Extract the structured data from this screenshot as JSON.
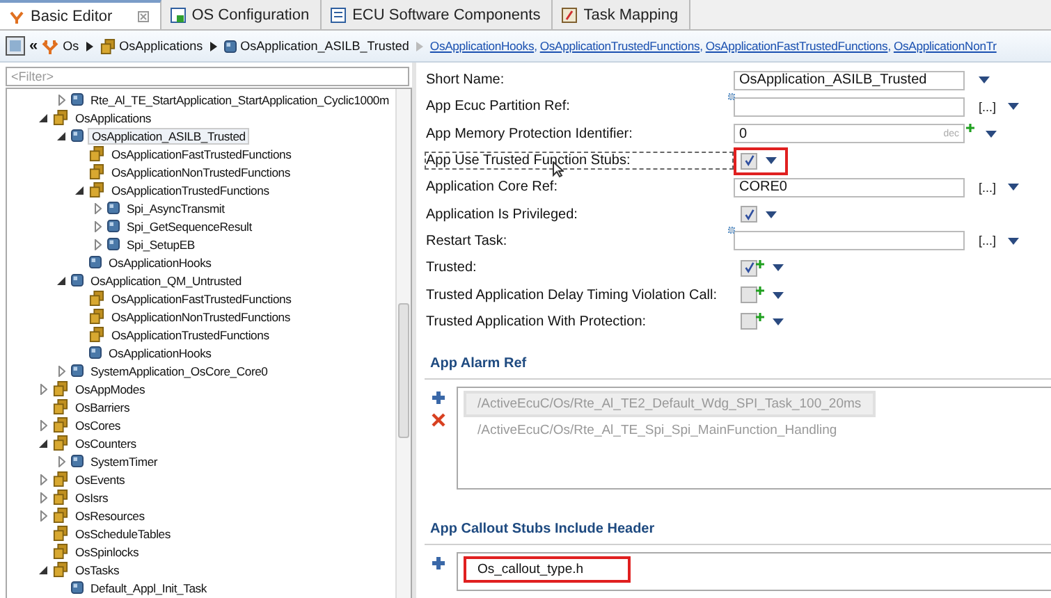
{
  "tabs": [
    {
      "label": "Basic Editor",
      "selected": true
    },
    {
      "label": "OS Configuration",
      "selected": false
    },
    {
      "label": "ECU Software Components",
      "selected": false
    },
    {
      "label": "Task Mapping",
      "selected": false
    }
  ],
  "breadcrumb": {
    "back_glyph": "«",
    "items": [
      {
        "label": "Os"
      },
      {
        "label": "OsApplications"
      },
      {
        "label": "OsApplication_ASILB_Trusted"
      }
    ],
    "links": [
      "OsApplicationHooks",
      "OsApplicationTrustedFunctions",
      "OsApplicationFastTrustedFunctions",
      "OsApplicationNonTr"
    ],
    "link_separator": ","
  },
  "filter": {
    "placeholder": "<Filter>"
  },
  "tree": {
    "continued_children": [
      {
        "label": "Rte_Al_TE_StartApplication_StartApplication_Cyclic1000m",
        "kind": "item",
        "expanded": false
      }
    ],
    "items": [
      {
        "label": "OsApplications",
        "kind": "container",
        "expanded": true,
        "children": [
          {
            "label": "OsApplication_ASILB_Trusted",
            "kind": "item",
            "expanded": true,
            "selected": true,
            "children": [
              {
                "label": "OsApplicationFastTrustedFunctions",
                "kind": "container"
              },
              {
                "label": "OsApplicationNonTrustedFunctions",
                "kind": "container"
              },
              {
                "label": "OsApplicationTrustedFunctions",
                "kind": "container",
                "expanded": true,
                "children": [
                  {
                    "label": "Spi_AsyncTransmit",
                    "kind": "item",
                    "expanded": false
                  },
                  {
                    "label": "Spi_GetSequenceResult",
                    "kind": "item",
                    "expanded": false
                  },
                  {
                    "label": "Spi_SetupEB",
                    "kind": "item",
                    "expanded": false
                  }
                ]
              },
              {
                "label": "OsApplicationHooks",
                "kind": "item"
              }
            ]
          },
          {
            "label": "OsApplication_QM_Untrusted",
            "kind": "item",
            "expanded": true,
            "selected": false,
            "children": [
              {
                "label": "OsApplicationFastTrustedFunctions",
                "kind": "container"
              },
              {
                "label": "OsApplicationNonTrustedFunctions",
                "kind": "container"
              },
              {
                "label": "OsApplicationTrustedFunctions",
                "kind": "container"
              },
              {
                "label": "OsApplicationHooks",
                "kind": "item"
              }
            ]
          },
          {
            "label": "SystemApplication_OsCore_Core0",
            "kind": "item",
            "expanded": false
          }
        ]
      },
      {
        "label": "OsAppModes",
        "kind": "container",
        "expanded": false
      },
      {
        "label": "OsBarriers",
        "kind": "container"
      },
      {
        "label": "OsCores",
        "kind": "container",
        "expanded": false
      },
      {
        "label": "OsCounters",
        "kind": "container",
        "expanded": true,
        "children": [
          {
            "label": "SystemTimer",
            "kind": "item",
            "expanded": false
          }
        ]
      },
      {
        "label": "OsEvents",
        "kind": "container",
        "expanded": false
      },
      {
        "label": "OsIsrs",
        "kind": "container",
        "expanded": false
      },
      {
        "label": "OsResources",
        "kind": "container",
        "expanded": false
      },
      {
        "label": "OsScheduleTables",
        "kind": "container"
      },
      {
        "label": "OsSpinlocks",
        "kind": "container"
      },
      {
        "label": "OsTasks",
        "kind": "container",
        "expanded": true,
        "children": [
          {
            "label": "Default_Appl_Init_Task",
            "kind": "item"
          }
        ]
      }
    ]
  },
  "form": [
    {
      "label": "Short Name:",
      "kind": "text",
      "value": "OsApplication_ASILB_Trusted"
    },
    {
      "label": "App Ecuc Partition Ref:",
      "kind": "ref",
      "browse": "[...]"
    },
    {
      "label": "App Memory Protection Identifier:",
      "kind": "number",
      "value": "0",
      "unit": "dec",
      "modified": true
    },
    {
      "label": "App Use Trusted Function Stubs:",
      "kind": "checkbox",
      "checked": true,
      "focused": true,
      "highlighted": true
    },
    {
      "label": "Application Core Ref:",
      "kind": "ref",
      "value": "CORE0",
      "browse": "[...]"
    },
    {
      "label": "Application Is Privileged:",
      "kind": "checkbox",
      "checked": true
    },
    {
      "label": "Restart Task:",
      "kind": "ref",
      "browse": "[...]"
    },
    {
      "label": "Trusted:",
      "kind": "checkbox",
      "checked": true,
      "modified": true
    },
    {
      "label": "Trusted Application Delay Timing Violation Call:",
      "kind": "checkbox",
      "checked": false,
      "modified": true
    },
    {
      "label": "Trusted Application With Protection:",
      "kind": "checkbox",
      "checked": false,
      "modified": true
    }
  ],
  "sections": [
    {
      "title": "App Alarm Ref",
      "removable": true,
      "items": [
        {
          "text": "/ActiveEcuC/Os/Rte_Al_TE2_Default_Wdg_SPI_Task_100_20ms",
          "selected": true,
          "highlighted": false
        },
        {
          "text": "/ActiveEcuC/Os/Rte_Al_TE_Spi_Spi_MainFunction_Handling",
          "selected": false,
          "highlighted": false
        }
      ]
    },
    {
      "title": "App Callout Stubs Include Header",
      "items": [
        {
          "text": "Os_callout_type.h",
          "selected": false,
          "highlighted": true
        }
      ]
    }
  ]
}
